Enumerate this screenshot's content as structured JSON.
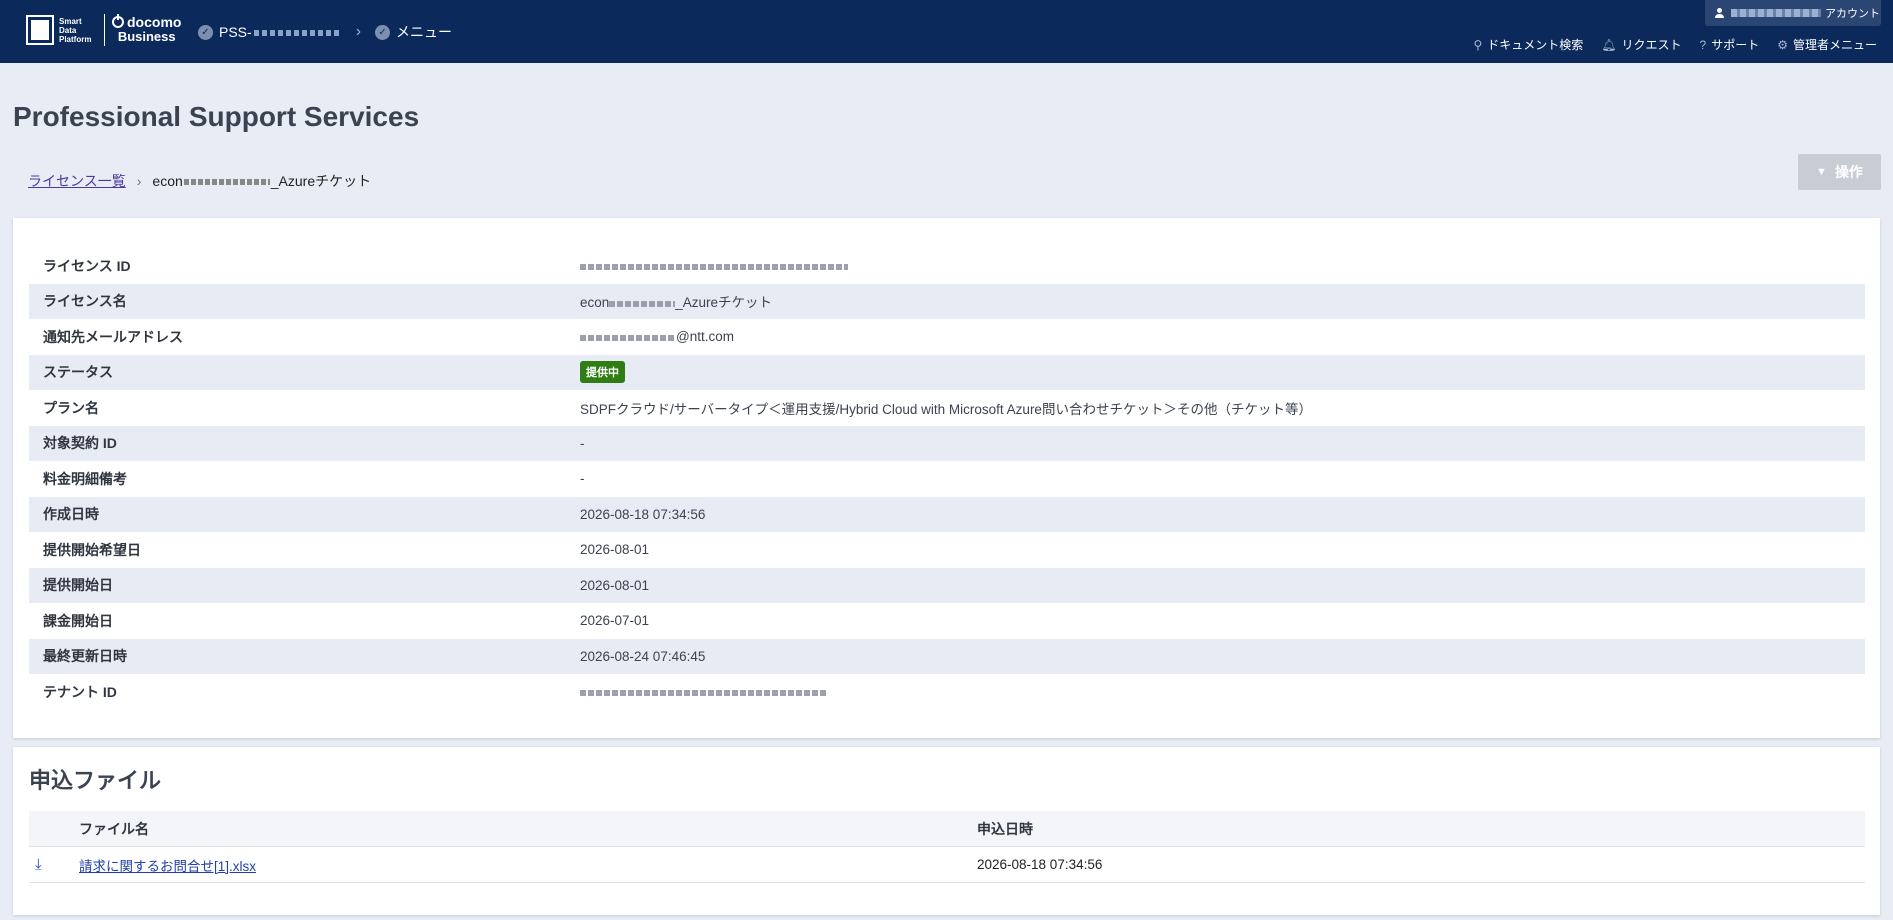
{
  "header": {
    "sdp_logo_text": [
      "Smart",
      "Data",
      "Platform"
    ],
    "docomo_line1": "docomo",
    "docomo_line2": "Business",
    "breadcrumb_pss": "PSS-",
    "breadcrumb_menu": "メニュー",
    "account_suffix": "アカウント",
    "nav": [
      {
        "label": "ドキュメント検索",
        "icon": "search-icon"
      },
      {
        "label": "リクエスト",
        "icon": "bell-icon"
      },
      {
        "label": "サポート",
        "icon": "help-icon"
      },
      {
        "label": "管理者メニュー",
        "icon": "gear-icon"
      }
    ]
  },
  "page": {
    "title": "Professional Support Services",
    "breadcrumb": {
      "link": "ライセンス一覧",
      "current_prefix": "econ",
      "current_suffix": "_Azureチケット"
    },
    "op_button": "操作"
  },
  "details": {
    "license_id_label": "ライセンス ID",
    "license_name_label": "ライセンス名",
    "license_name_prefix": "econ",
    "license_name_suffix": "_Azureチケット",
    "email_label": "通知先メールアドレス",
    "email_suffix": "@ntt.com",
    "status_label": "ステータス",
    "status_value": "提供中",
    "plan_label": "プラン名",
    "plan_value": "SDPFクラウド/サーバータイプ＜運用支援/Hybrid Cloud with Microsoft Azure問い合わせチケット＞その他（チケット等）",
    "contract_label": "対象契約 ID",
    "contract_value": "-",
    "billing_note_label": "料金明細備考",
    "billing_note_value": "-",
    "created_label": "作成日時",
    "created_value": "2026-08-18 07:34:56",
    "desired_start_label": "提供開始希望日",
    "desired_start_value": "2026-08-01",
    "start_label": "提供開始日",
    "start_value": "2026-08-01",
    "billing_start_label": "課金開始日",
    "billing_start_value": "2026-07-01",
    "updated_label": "最終更新日時",
    "updated_value": "2026-08-24 07:46:45",
    "tenant_label": "テナント ID"
  },
  "files": {
    "title": "申込ファイル",
    "col_name": "ファイル名",
    "col_date": "申込日時",
    "rows": [
      {
        "name": "請求に関するお問合せ[1].xlsx",
        "date": "2026-08-18 07:34:56"
      }
    ]
  },
  "colors": {
    "header_bg": "#0b2a5b",
    "page_bg": "#e8edf5",
    "status_badge": "#2f7d14",
    "link": "#1f3fae"
  }
}
